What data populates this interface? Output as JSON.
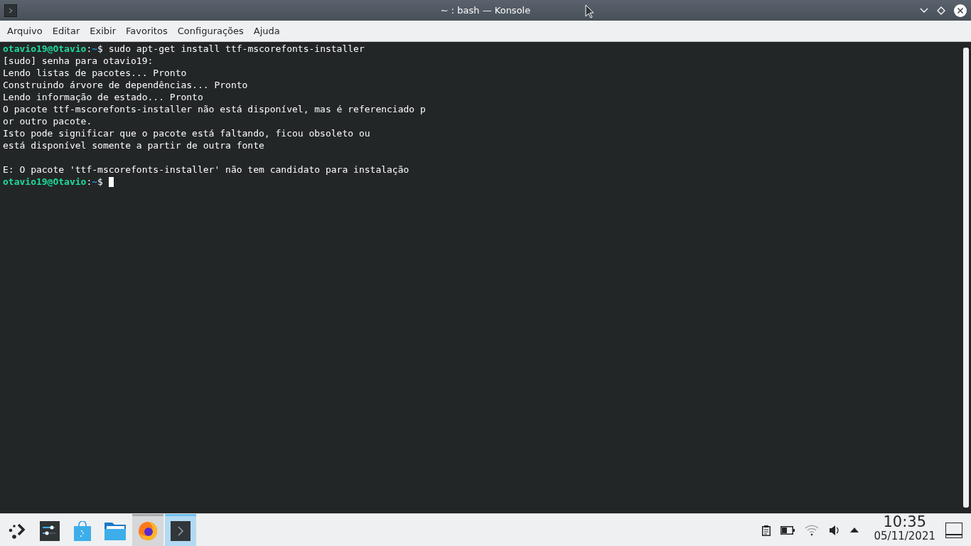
{
  "window": {
    "title": "~ : bash — Konsole"
  },
  "menu": [
    "Arquivo",
    "Editar",
    "Exibir",
    "Favoritos",
    "Configurações",
    "Ajuda"
  ],
  "terminal": {
    "lines": [
      {
        "kind": "prompt",
        "user": "otavio19@Otavio",
        "sep": ":",
        "path": "~",
        "symbol": "$",
        "command": " sudo apt-get install ttf-mscorefonts-installer",
        "cursor": false
      },
      {
        "kind": "output",
        "text": "[sudo] senha para otavio19:"
      },
      {
        "kind": "output",
        "text": "Lendo listas de pacotes... Pronto"
      },
      {
        "kind": "output",
        "text": "Construindo árvore de dependências... Pronto"
      },
      {
        "kind": "output",
        "text": "Lendo informação de estado... Pronto"
      },
      {
        "kind": "output",
        "text": "O pacote ttf-mscorefonts-installer não está disponível, mas é referenciado p"
      },
      {
        "kind": "output",
        "text": "or outro pacote."
      },
      {
        "kind": "output",
        "text": "Isto pode significar que o pacote está faltando, ficou obsoleto ou"
      },
      {
        "kind": "output",
        "text": "está disponível somente a partir de outra fonte"
      },
      {
        "kind": "blank"
      },
      {
        "kind": "output",
        "text": "E: O pacote 'ttf-mscorefonts-installer' não tem candidato para instalação"
      },
      {
        "kind": "prompt",
        "user": "otavio19@Otavio",
        "sep": ":",
        "path": "~",
        "symbol": "$",
        "cursor": true
      }
    ]
  },
  "taskbar": {
    "launchers": [
      {
        "kind": "mixer",
        "running": false,
        "selected": false
      },
      {
        "kind": "store",
        "running": false,
        "selected": false
      },
      {
        "kind": "folder",
        "running": false,
        "selected": false
      },
      {
        "kind": "browser",
        "running": true,
        "selected": false
      },
      {
        "kind": "terminal",
        "selected": true
      }
    ],
    "tray": [
      {
        "kind": "clipboard"
      },
      {
        "kind": "battery"
      },
      {
        "kind": "wifi"
      },
      {
        "kind": "volume"
      },
      {
        "kind": "expand"
      }
    ],
    "clock": {
      "time": "10:35",
      "date": "05/11/2021"
    }
  }
}
